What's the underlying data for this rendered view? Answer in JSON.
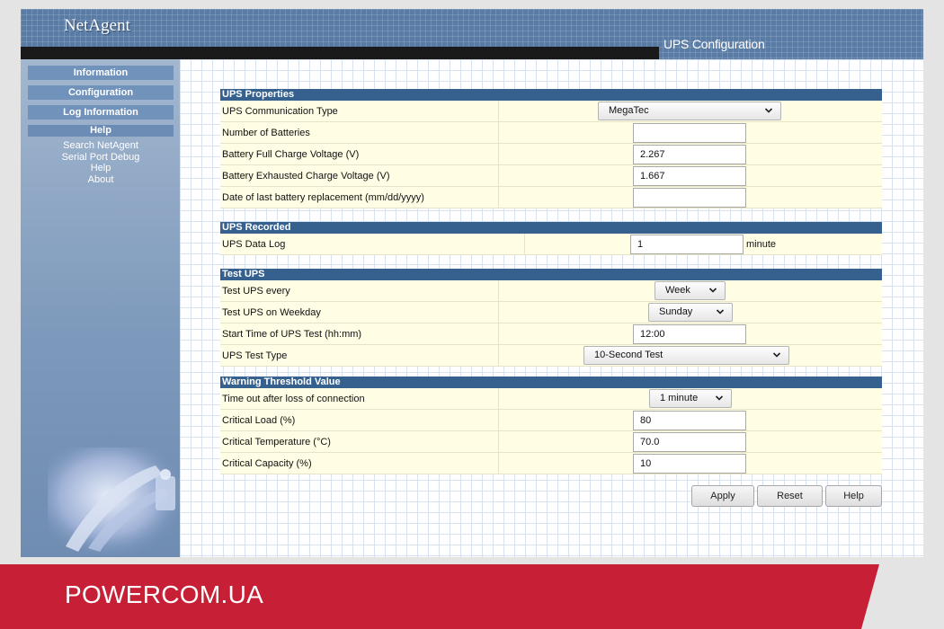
{
  "header": {
    "brand": "NetAgent",
    "page_title": "UPS Configuration"
  },
  "sidebar": {
    "tabs": [
      {
        "label": "Information"
      },
      {
        "label": "Configuration"
      },
      {
        "label": "Log Information"
      }
    ],
    "help_header": "Help",
    "help_links": [
      {
        "label": "Search NetAgent"
      },
      {
        "label": "Serial Port Debug"
      },
      {
        "label": "Help"
      },
      {
        "label": "About"
      }
    ]
  },
  "sections": {
    "ups_properties": {
      "title": "UPS Properties",
      "communication_type": {
        "label": "UPS Communication Type",
        "value": "MegaTec"
      },
      "number_of_batteries": {
        "label": "Number of Batteries",
        "value": ""
      },
      "full_charge_voltage": {
        "label": "Battery Full Charge Voltage (V)",
        "value": "2.267"
      },
      "exhausted_charge_voltage": {
        "label": "Battery Exhausted Charge Voltage (V)",
        "value": "1.667"
      },
      "last_replacement": {
        "label": "Date of last battery replacement (mm/dd/yyyy)",
        "value": ""
      }
    },
    "ups_recorded": {
      "title": "UPS Recorded",
      "data_log": {
        "label": "UPS Data Log",
        "value": "1",
        "unit": "minute"
      }
    },
    "test_ups": {
      "title": "Test UPS",
      "every": {
        "label": "Test UPS every",
        "value": "Week"
      },
      "weekday": {
        "label": "Test UPS on Weekday",
        "value": "Sunday"
      },
      "start_time": {
        "label": "Start Time of UPS Test (hh:mm)",
        "value": "12:00"
      },
      "test_type": {
        "label": "UPS Test Type",
        "value": "10-Second Test"
      }
    },
    "warning_threshold": {
      "title": "Warning Threshold Value",
      "timeout": {
        "label": "Time out after loss of connection",
        "value": "1 minute"
      },
      "critical_load": {
        "label": "Critical Load (%)",
        "value": "80"
      },
      "critical_temperature": {
        "label": "Critical Temperature (°C)",
        "value": "70.0"
      },
      "critical_capacity": {
        "label": "Critical Capacity (%)",
        "value": "10"
      }
    }
  },
  "buttons": {
    "apply": "Apply",
    "reset": "Reset",
    "help": "Help"
  },
  "footer": {
    "brand": "POWERCOM.UA"
  },
  "colors": {
    "header_blue": "#5a7ba4",
    "section_header": "#36618f",
    "row_background": "#fffde4",
    "footer_red": "#c71f35"
  }
}
